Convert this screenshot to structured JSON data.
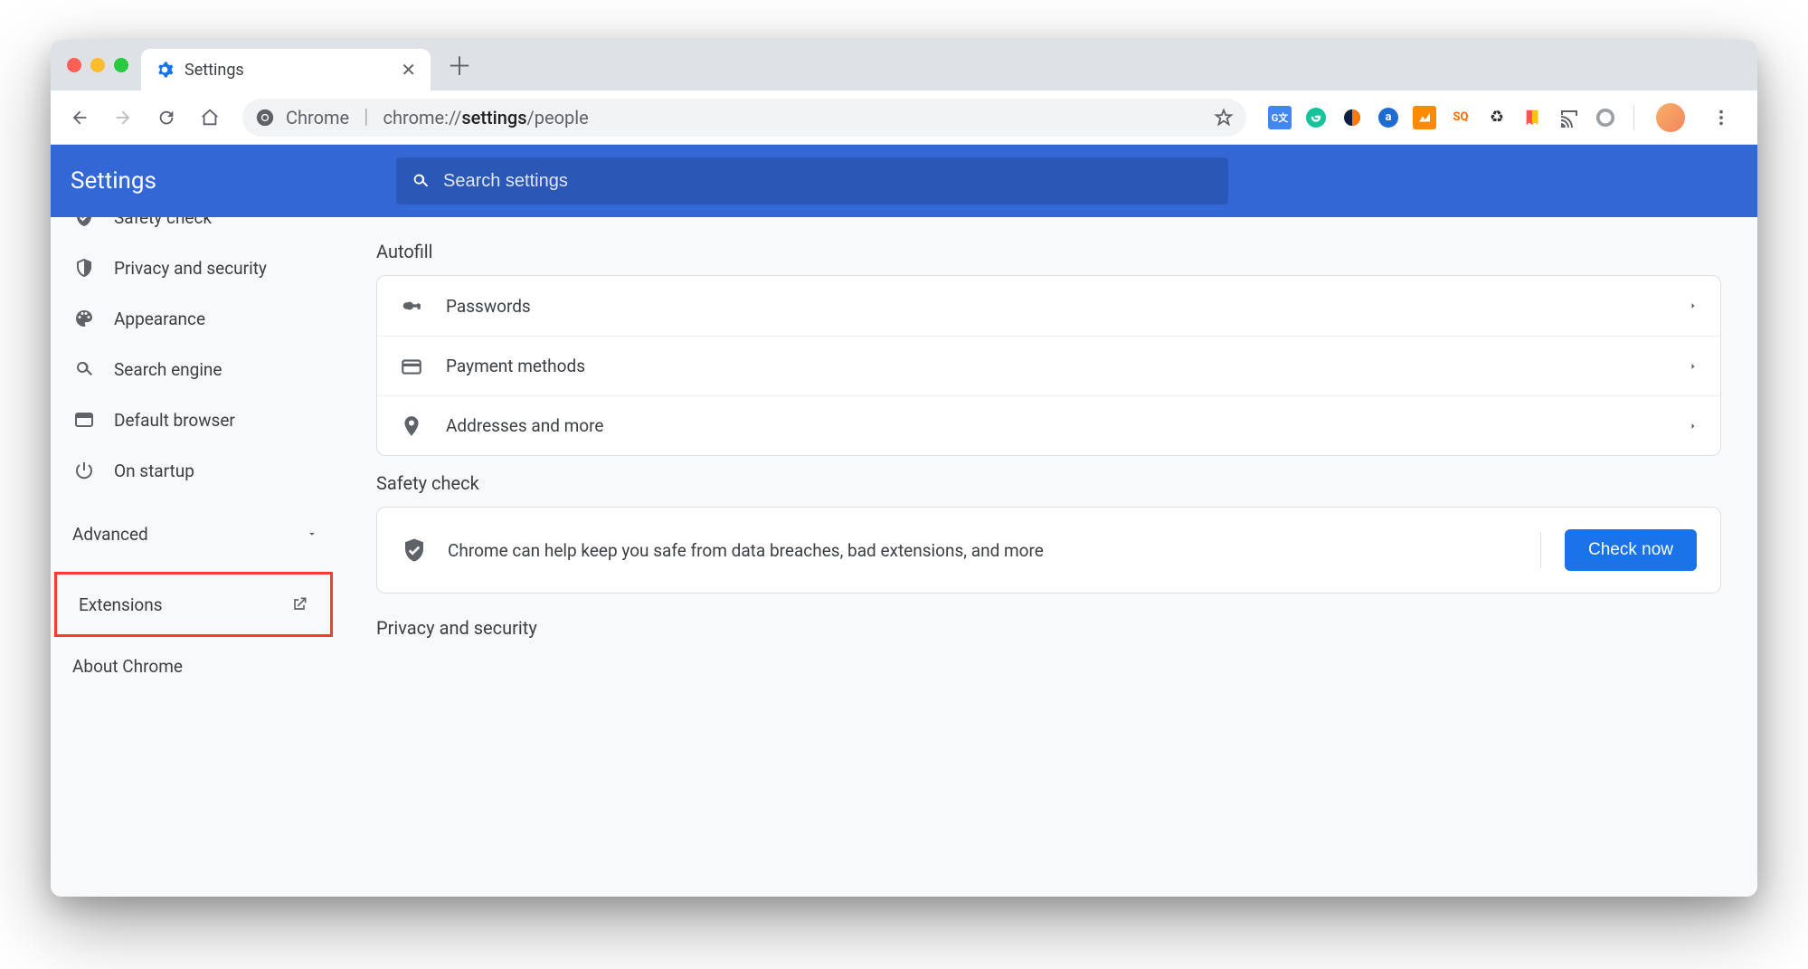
{
  "tab": {
    "title": "Settings"
  },
  "omnibox": {
    "product": "Chrome",
    "url_prefix": "chrome://",
    "url_bold": "settings",
    "url_suffix": "/people"
  },
  "header": {
    "title": "Settings",
    "search_placeholder": "Search settings"
  },
  "sidebar": {
    "items": [
      {
        "label": "Safety check"
      },
      {
        "label": "Privacy and security"
      },
      {
        "label": "Appearance"
      },
      {
        "label": "Search engine"
      },
      {
        "label": "Default browser"
      },
      {
        "label": "On startup"
      }
    ],
    "advanced": "Advanced",
    "extensions": "Extensions",
    "about": "About Chrome"
  },
  "main": {
    "autofill": {
      "title": "Autofill",
      "rows": [
        {
          "label": "Passwords"
        },
        {
          "label": "Payment methods"
        },
        {
          "label": "Addresses and more"
        }
      ]
    },
    "safety": {
      "title": "Safety check",
      "message": "Chrome can help keep you safe from data breaches, bad extensions, and more",
      "button": "Check now"
    },
    "privacy_title": "Privacy and security"
  }
}
